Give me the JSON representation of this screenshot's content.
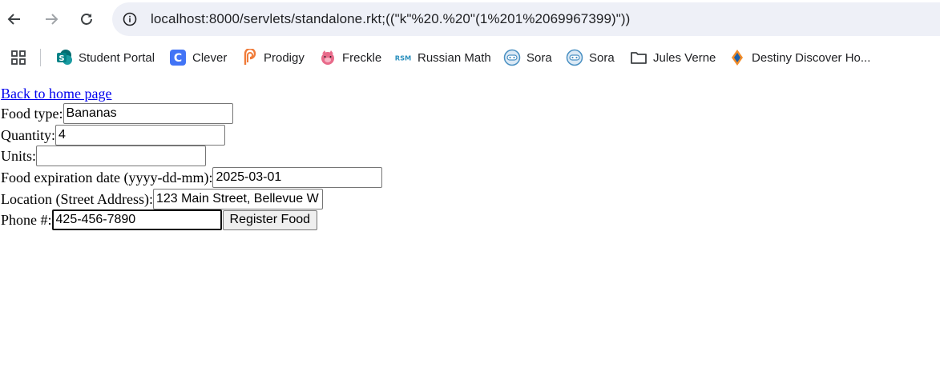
{
  "browser": {
    "url": "localhost:8000/servlets/standalone.rkt;((\"k\"%20.%20\"(1%201%2069967399)\"))",
    "bookmarks": [
      {
        "label": "Student Portal",
        "icon": "sharepoint-icon",
        "color": "#038387"
      },
      {
        "label": "Clever",
        "icon": "clever-icon",
        "color": "#4274f6"
      },
      {
        "label": "Prodigy",
        "icon": "prodigy-icon",
        "color": "#f07c3a"
      },
      {
        "label": "Freckle",
        "icon": "freckle-pig-icon",
        "color": "#e86a8a"
      },
      {
        "label": "Russian Math",
        "icon": "rsm-icon",
        "color": "#2a8fbd"
      },
      {
        "label": "Sora",
        "icon": "sora-icon",
        "color": "#4a90c2"
      },
      {
        "label": "Sora",
        "icon": "sora-icon",
        "color": "#4a90c2"
      },
      {
        "label": "Jules Verne",
        "icon": "folder-icon",
        "color": "#3c4043"
      },
      {
        "label": "Destiny Discover Ho...",
        "icon": "destiny-icon",
        "color": "#f28c28"
      }
    ]
  },
  "page": {
    "home_link": "Back to home page",
    "fields": {
      "food_type": {
        "label": "Food type:",
        "value": "Bananas"
      },
      "quantity": {
        "label": "Quantity:",
        "value": "4"
      },
      "units": {
        "label": "Units:",
        "value": ""
      },
      "expiration": {
        "label": "Food expiration date (yyyy-dd-mm):",
        "value": "2025-03-01"
      },
      "location": {
        "label": "Location (Street Address):",
        "value": "123 Main Street, Bellevue W"
      },
      "phone": {
        "label": "Phone #:",
        "value": "425-456-7890"
      }
    },
    "submit_label": "Register Food"
  }
}
